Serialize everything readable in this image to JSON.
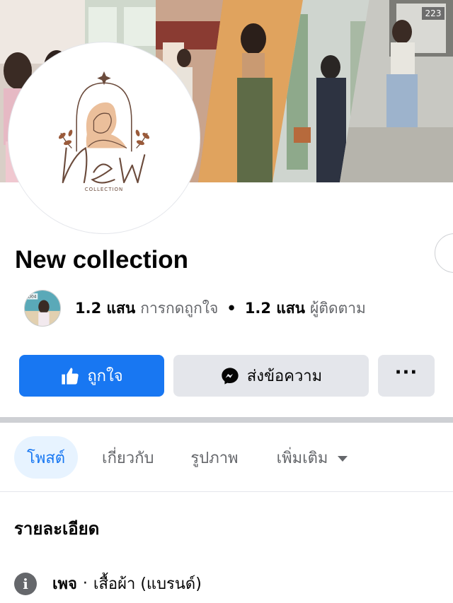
{
  "cover": {
    "badge": "223"
  },
  "profile": {
    "logo_caption": "COLLECTION",
    "page_name": "New collection"
  },
  "stats": {
    "likes_count": "1.2 แสน",
    "likes_label": "การกดถูกใจ",
    "separator": "•",
    "followers_count": "1.2 แสน",
    "followers_label": "ผู้ติดตาม",
    "avatar_label": "D04"
  },
  "actions": {
    "like_label": "ถูกใจ",
    "message_label": "ส่งข้อความ",
    "more_label": "···"
  },
  "tabs": [
    {
      "label": "โพสต์",
      "active": true
    },
    {
      "label": "เกี่ยวกับ",
      "active": false
    },
    {
      "label": "รูปภาพ",
      "active": false
    },
    {
      "label": "เพิ่มเติม",
      "active": false
    }
  ],
  "details": {
    "title": "รายละเอียด",
    "type_label": "เพจ",
    "separator": "·",
    "type_value": "เสื้อผ้า (แบรนด์)"
  },
  "colors": {
    "primary": "#1877f2",
    "button_gray": "#e4e6eb",
    "text_secondary": "#65676b",
    "logo_brown": "#6b4b3c"
  }
}
